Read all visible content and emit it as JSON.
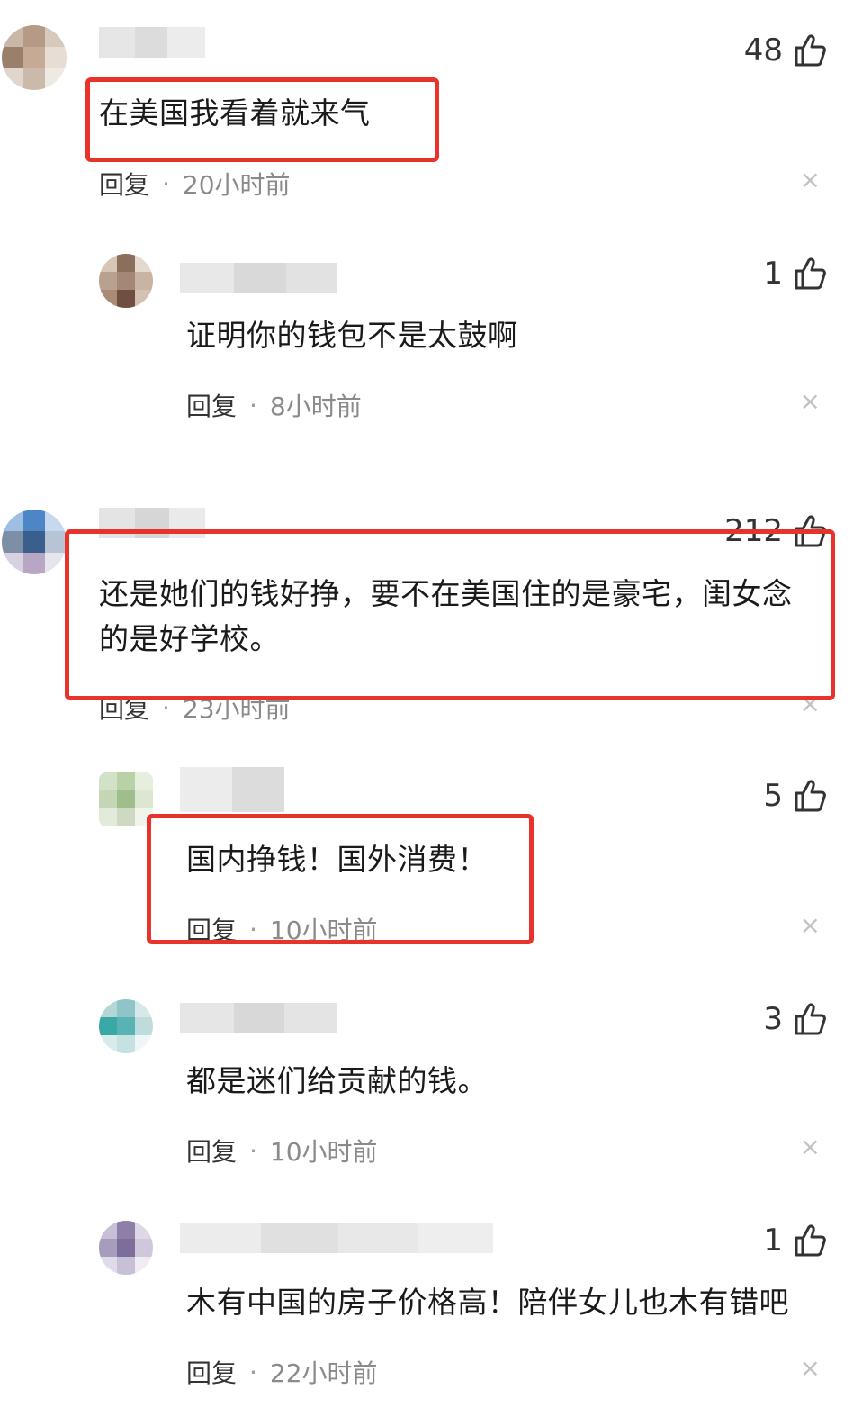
{
  "comments": [
    {
      "likes": "48",
      "text": "在美国我看着就来气",
      "reply": "回复",
      "dot": "·",
      "time": "20小时前",
      "close": "×"
    },
    {
      "likes": "1",
      "text": "证明你的钱包不是太鼓啊",
      "reply": "回复",
      "dot": "·",
      "time": "8小时前",
      "close": "×"
    },
    {
      "likes": "212",
      "text_line1": "还是她们的钱好挣，要不在美国住的是豪宅，闺女念",
      "text_line2": "的是好学校。",
      "reply": "回复",
      "dot": "·",
      "time": "23小时前",
      "close": "×"
    },
    {
      "likes": "5",
      "text": "国内挣钱！国外消费！",
      "reply": "回复",
      "dot": "·",
      "time": "10小时前",
      "close": "×"
    },
    {
      "likes": "3",
      "text": "都是迷们给贡献的钱。",
      "reply": "回复",
      "dot": "·",
      "time": "10小时前",
      "close": "×"
    },
    {
      "likes": "1",
      "text": "木有中国的房子价格高！陪伴女儿也木有错吧",
      "reply": "回复",
      "dot": "·",
      "time": "22小时前",
      "close": "×"
    }
  ],
  "colors": {
    "highlight": "#e8322c",
    "meta_text": "#8a8a8a"
  },
  "icons": {
    "like": "thumbs-up-icon",
    "close": "close-icon"
  }
}
